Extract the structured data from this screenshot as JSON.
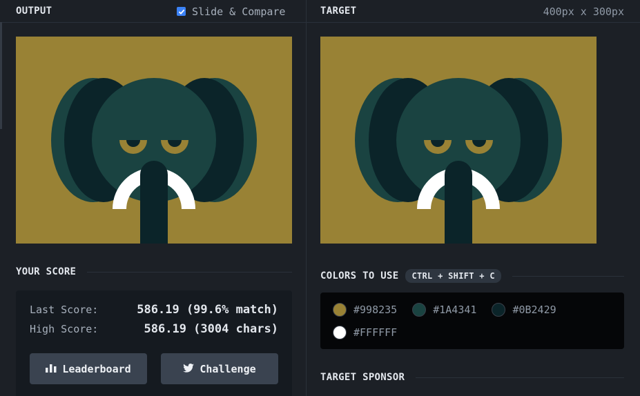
{
  "output": {
    "header_title": "OUTPUT",
    "slide_compare_label": "Slide & Compare",
    "slide_compare_checked": true
  },
  "target": {
    "header_title": "TARGET",
    "size_label": "400px x 300px"
  },
  "score": {
    "section_title": "YOUR SCORE",
    "last_score_label": "Last Score:",
    "last_score_value": "586.19 (99.6% match)",
    "high_score_label": "High Score:",
    "high_score_value": "586.19 (3004 chars)",
    "leaderboard_label": "Leaderboard",
    "challenge_label": "Challenge"
  },
  "colors": {
    "section_title": "COLORS TO USE",
    "shortcut": "CTRL + SHIFT + C",
    "swatches": [
      {
        "hex": "#998235",
        "label": "#998235"
      },
      {
        "hex": "#1A4341",
        "label": "#1A4341"
      },
      {
        "hex": "#0B2429",
        "label": "#0B2429"
      },
      {
        "hex": "#FFFFFF",
        "label": "#FFFFFF"
      }
    ]
  },
  "sponsor": {
    "section_title": "TARGET SPONSOR"
  },
  "icons": {
    "leaderboard": "bar-chart-icon",
    "challenge": "twitter-bird-icon",
    "checkbox": "checkmark-icon"
  },
  "palette": {
    "background": "#998235",
    "head": "#1A4341",
    "dark": "#0B2429",
    "white": "#FFFFFF"
  }
}
